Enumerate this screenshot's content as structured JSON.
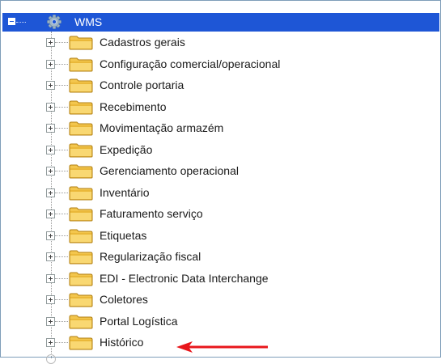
{
  "tree": {
    "root": {
      "label": "WMS",
      "icon": "gear-icon",
      "expanded": true,
      "selected": true,
      "highlight_color": "#1e56d6"
    },
    "items": [
      {
        "label": "Cadastros gerais",
        "icon": "folder-icon"
      },
      {
        "label": "Configuração comercial/operacional",
        "icon": "folder-icon"
      },
      {
        "label": "Controle portaria",
        "icon": "folder-icon"
      },
      {
        "label": "Recebimento",
        "icon": "folder-icon"
      },
      {
        "label": "Movimentação armazém",
        "icon": "folder-icon"
      },
      {
        "label": "Expedição",
        "icon": "folder-icon"
      },
      {
        "label": "Gerenciamento operacional",
        "icon": "folder-icon"
      },
      {
        "label": "Inventário",
        "icon": "folder-icon"
      },
      {
        "label": "Faturamento serviço",
        "icon": "folder-icon"
      },
      {
        "label": "Etiquetas",
        "icon": "folder-icon"
      },
      {
        "label": "Regularização fiscal",
        "icon": "folder-icon"
      },
      {
        "label": "EDI - Electronic Data Interchange",
        "icon": "folder-icon"
      },
      {
        "label": "Coletores",
        "icon": "folder-icon"
      },
      {
        "label": "Portal Logística",
        "icon": "folder-icon"
      },
      {
        "label": "Histórico",
        "icon": "folder-icon"
      }
    ]
  },
  "annotation": {
    "icon": "red-arrow-icon",
    "color": "#e8161b",
    "points_to": "Histórico"
  }
}
